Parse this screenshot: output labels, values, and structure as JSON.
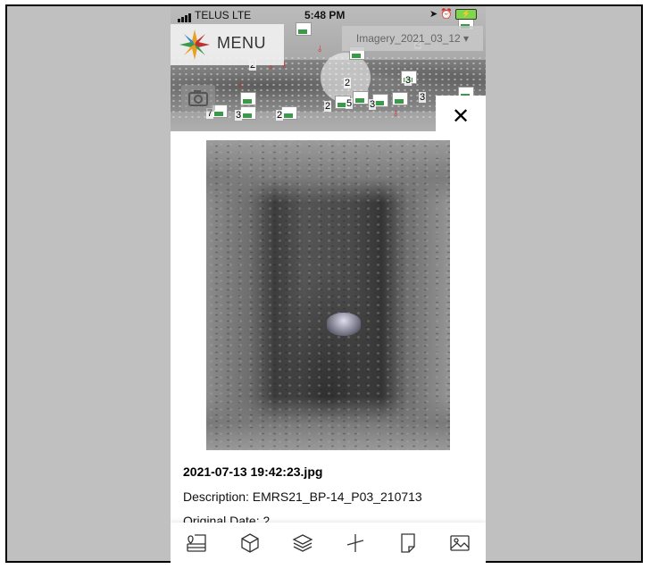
{
  "status_bar": {
    "carrier": "TELUS",
    "network": "LTE",
    "time": "5:48 PM"
  },
  "map": {
    "menu_label": "MENU",
    "imagery_selector": "Imagery_2021_03_12",
    "cluster_counts": [
      "2",
      "2",
      "3",
      "2",
      "5",
      "3",
      "3",
      "7",
      "3",
      "2",
      "2"
    ]
  },
  "close_label": "✕",
  "detail": {
    "filename": "2021-07-13 19:42:23.jpg",
    "description": "Description: EMRS21_BP-14_P03_210713",
    "original_date": "Original Date: 2"
  },
  "tabs": [
    {
      "icon": "map-layers-icon"
    },
    {
      "icon": "cube-icon"
    },
    {
      "icon": "layers-icon"
    },
    {
      "icon": "measure-icon"
    },
    {
      "icon": "note-icon"
    },
    {
      "icon": "image-icon"
    }
  ],
  "colors": {
    "accent_green": "#3a9a4a",
    "pdf_red": "#dd2222",
    "frame_gray": "#c0c0c0"
  }
}
